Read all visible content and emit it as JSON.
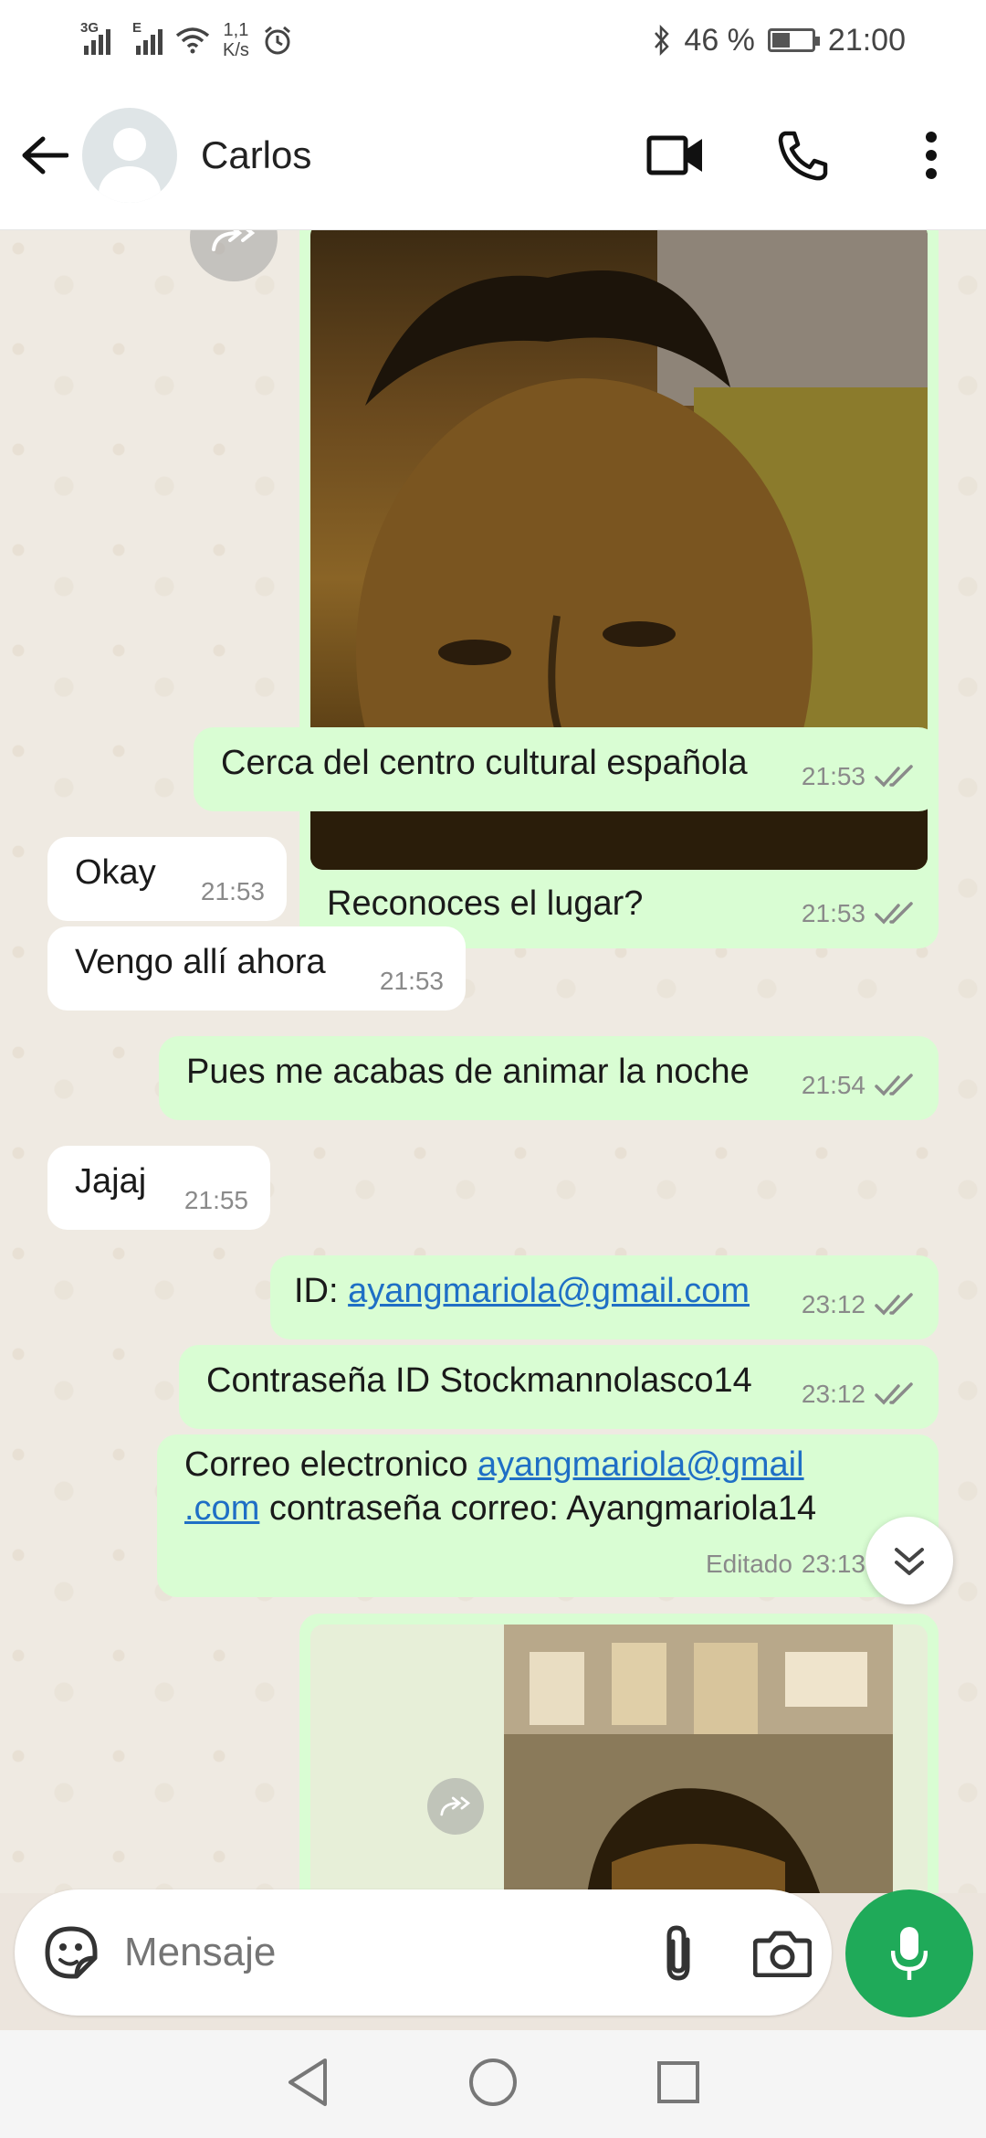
{
  "status_bar": {
    "network1": "3G",
    "network2": "E",
    "speed_value": "1,1",
    "speed_unit": "K/s",
    "battery": "46 %",
    "time": "21:00"
  },
  "header": {
    "contact_name": "Carlos"
  },
  "messages": [
    {
      "dir": "out",
      "kind": "image_caption",
      "text": "Reconoces el lugar?",
      "time": "21:53"
    },
    {
      "dir": "out",
      "text": "Cerca del centro cultural española",
      "time": "21:53"
    },
    {
      "dir": "in",
      "text": "Okay",
      "time": "21:53"
    },
    {
      "dir": "in",
      "text": "Vengo allí ahora",
      "time": "21:53"
    },
    {
      "dir": "out",
      "text": "Pues me acabas de animar la noche",
      "time": "21:54"
    },
    {
      "dir": "in",
      "text": "Jajaj",
      "time": "21:55"
    },
    {
      "dir": "out",
      "prefix": "ID: ",
      "link": "ayangmariola@gmail.com",
      "time": "23:12"
    },
    {
      "dir": "out",
      "text": "Contraseña ID Stockmannolasco14",
      "time": "23:12"
    },
    {
      "dir": "out",
      "prefix": "Correo electronico ",
      "link_part1": "ayangmariola@gmail",
      "link_part2": ".com",
      "suffix": " contraseña correo: Ayangmariola14",
      "edited": "Editado",
      "time": "23:13"
    }
  ],
  "input": {
    "placeholder": "Mensaje"
  },
  "colors": {
    "outgoing_bubble": "#d9fdd3",
    "incoming_bubble": "#ffffff",
    "accent_green": "#1faa59",
    "link": "#1f6fc5"
  }
}
